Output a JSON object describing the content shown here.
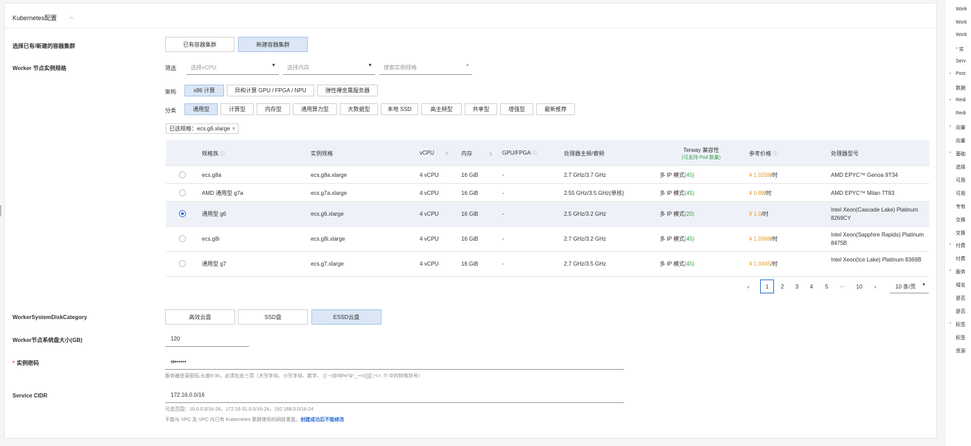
{
  "panel": {
    "title": "Kubernetes配置"
  },
  "cluster": {
    "label": "选择已有/新建的容器集群",
    "options": [
      "已有容器集群",
      "新建容器集群"
    ],
    "selected": 1
  },
  "worker_spec": {
    "label": "Worker 节点实例规格",
    "filter_label": "筛选",
    "vcpu_placeholder": "选择vCPU",
    "memory_placeholder": "选择内存",
    "search_placeholder": "搜索实例规格",
    "arch_label": "架构",
    "arch": [
      "x86 计算",
      "异构计算 GPU / FPGA / NPU",
      "弹性裸金属服务器"
    ],
    "category_label": "分类",
    "categories": [
      "通用型",
      "计算型",
      "内存型",
      "通用算力型",
      "大数据型",
      "本地 SSD",
      "高主频型",
      "共享型",
      "增强型",
      "最新推荐"
    ],
    "selected_tag": "已选规格：ecs.g6.xlarge"
  },
  "table": {
    "headers": {
      "family": "规格族",
      "spec": "实例规格",
      "vcpu": "vCPU",
      "memory": "内存",
      "gpu": "GPU/FPGA",
      "freq": "处理器主频/睿频",
      "terway": "Terway 兼容性",
      "terway_sub": "(可支持 Pod 数量)",
      "price": "参考价格",
      "processor": "处理器型号"
    },
    "rows": [
      {
        "family": "ecs.g8a",
        "spec": "ecs.g8a.xlarge",
        "vcpu": "4 vCPU",
        "memory": "16 GiB",
        "gpu": "-",
        "freq": "2.7 GHz/3.7 GHz",
        "terway": "多 IP 模式",
        "pods": "(45)",
        "price": "¥ 1.0208",
        "unit": "/时",
        "processor": "AMD EPYC™ Genoa 9T34",
        "selected": false
      },
      {
        "family": "AMD 通用型 g7a",
        "spec": "ecs.g7a.xlarge",
        "vcpu": "4 vCPU",
        "memory": "16 GiB",
        "gpu": "-",
        "freq": "2.55 GHz/3.5 GHz(单核)",
        "terway": "多 IP 模式",
        "pods": "(45)",
        "price": "¥ 0.88",
        "unit": "/时",
        "processor": "AMD EPYC™ Milan 7T83",
        "selected": false
      },
      {
        "family": "通用型 g6",
        "spec": "ecs.g6.xlarge",
        "vcpu": "4 vCPU",
        "memory": "16 GiB",
        "gpu": "-",
        "freq": "2.5 GHz/3.2 GHz",
        "terway": "多 IP 模式",
        "pods": "(20)",
        "price": "¥ 1.0",
        "unit": "/时",
        "processor": "Intel Xeon(Cascade Lake) Platinum 8269CY",
        "selected": true
      },
      {
        "family": "ecs.g8i",
        "spec": "ecs.g8i.xlarge",
        "vcpu": "4 vCPU",
        "memory": "16 GiB",
        "gpu": "-",
        "freq": "2.7 GHz/3.2 GHz",
        "terway": "多 IP 模式",
        "pods": "(45)",
        "price": "¥ 1.0988",
        "unit": "/时",
        "processor": "Intel Xeon(Sapphire Rapids) Platinum 8475B",
        "selected": false
      },
      {
        "family": "通用型 g7",
        "spec": "ecs.g7.xlarge",
        "vcpu": "4 vCPU",
        "memory": "16 GiB",
        "gpu": "-",
        "freq": "2.7 GHz/3.5 GHz",
        "terway": "多 IP 模式",
        "pods": "(45)",
        "price": "¥ 1.0465",
        "unit": "/时",
        "processor": "Intel Xeon(Ice Lake) Platinum 8369B",
        "selected": false
      }
    ]
  },
  "pagination": {
    "pages": [
      "1",
      "2",
      "3",
      "4",
      "5",
      "10"
    ],
    "ellipsis": "···",
    "current": 1,
    "page_size": "10 条/页"
  },
  "disk_category": {
    "label": "WorkerSystemDiskCategory",
    "options": [
      "高效云盘",
      "SSD盘",
      "ESSD云盘"
    ],
    "selected": 2
  },
  "disk_size": {
    "label": "Worker节点系统盘大小(GB)",
    "value": "120"
  },
  "password": {
    "required_mark": "*",
    "label": "实例密码",
    "value": "••••••••",
    "hint": "服务器登录密码,长度8-30，必须包含三项（大写字母、小写字母、数字、 ()`~!@#$%^&*_-+=|{}[]:;'<>,.?/ 中的特殊符号）"
  },
  "cidr": {
    "label": "Service CIDR",
    "value": "172.16.0.0/16",
    "hint_range": "可选范围：10.0.0.0/16-24，172.16-31.0.0/16-24，192.168.0.0/16-24",
    "hint_conflict": "不能与 VPC 及 VPC 内已有 Kubernetes 集群使用的网段重复。",
    "hint_emphasis": "创建成功后不能修改"
  },
  "side": {
    "req_mark": "*",
    "items": [
      "Work",
      "Work",
      "Work",
      "实",
      "Serv",
      "Post",
      "数据",
      "Redi",
      "Redi",
      "向量",
      "向量",
      "基础",
      "选择",
      "可用",
      "可用",
      "专有",
      "交换",
      "交换",
      "付费",
      "付费",
      "服务",
      "域名",
      "是否",
      "是否",
      "标签",
      "标签",
      "资源"
    ]
  },
  "colors": {
    "accent": "#2a6cd1",
    "selected_bg": "#dbe7f6",
    "price": "#e89b1a",
    "pods": "#2e9e45",
    "required": "#e34d4d"
  }
}
